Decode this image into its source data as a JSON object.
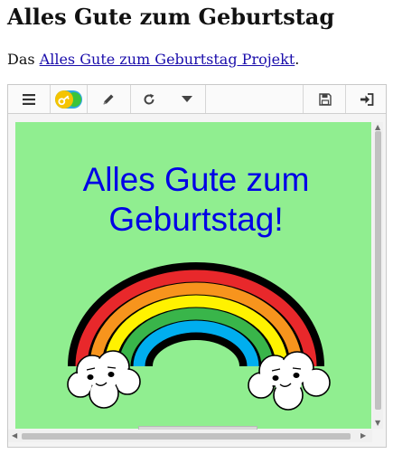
{
  "page": {
    "title": "Alles Gute zum Geburtstag",
    "intro_prefix": "Das ",
    "intro_link": "Alles Gute zum Geburtstag Projekt",
    "intro_suffix": "."
  },
  "toolbar": {
    "buttons": [
      {
        "name": "menu-icon"
      },
      {
        "name": "login-key-icon"
      },
      {
        "name": "pencil-icon"
      },
      {
        "name": "reload-icon"
      },
      {
        "name": "dropdown-caret-icon"
      },
      {
        "name": "save-icon"
      },
      {
        "name": "sign-in-icon"
      }
    ]
  },
  "stage": {
    "title_line1": "Alles Gute zum",
    "title_line2": "Geburtstag!",
    "background": "#90ee90",
    "title_color": "#0000e6",
    "rainbow_colors": [
      "#e8282b",
      "#f7941d",
      "#fff200",
      "#39b54a",
      "#00aeef"
    ]
  }
}
